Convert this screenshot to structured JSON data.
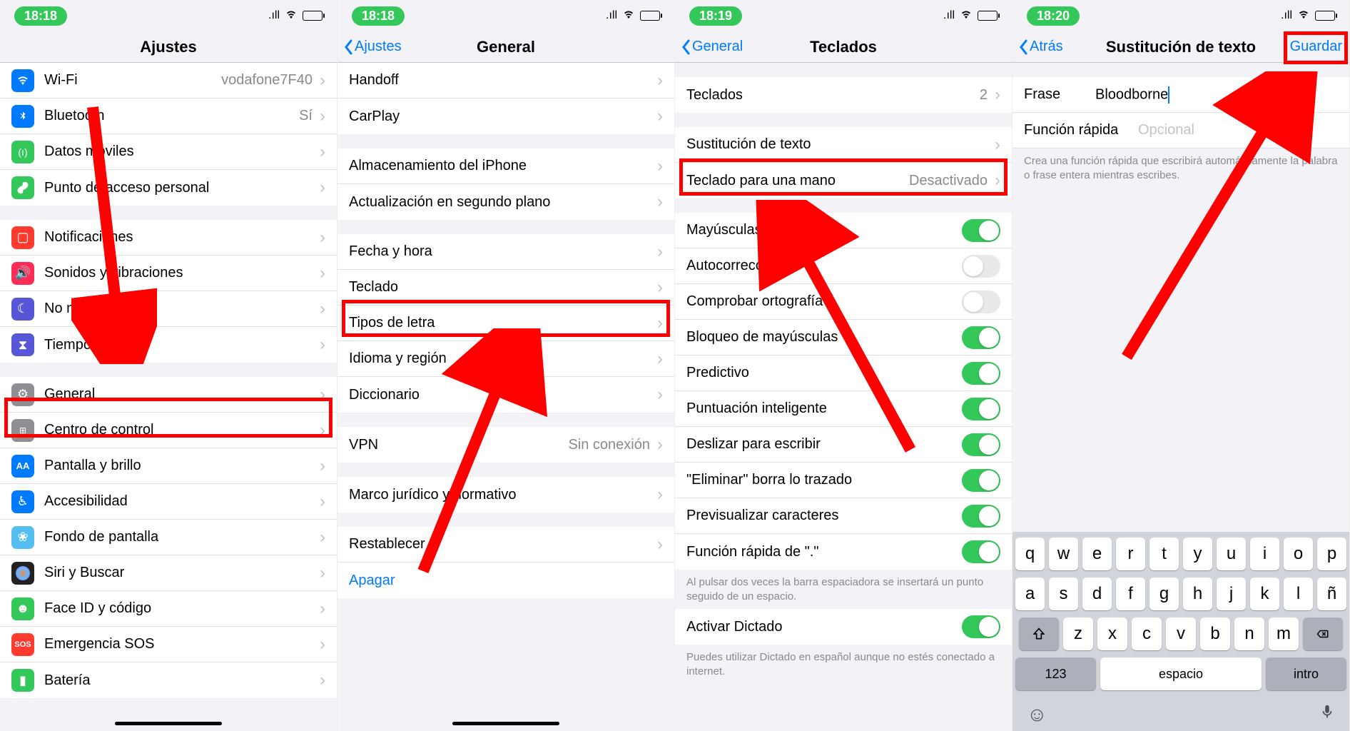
{
  "screen1": {
    "time": "18:18",
    "title": "Ajustes",
    "rows_g1": [
      {
        "label": "Wi-Fi",
        "value": "vodafone7F40",
        "icon_bg": "#007aff",
        "icon": "wifi"
      },
      {
        "label": "Bluetooth",
        "value": "Sí",
        "icon_bg": "#007aff",
        "icon": "bt"
      },
      {
        "label": "Datos móviles",
        "value": "",
        "icon_bg": "#34c759",
        "icon": "ant"
      },
      {
        "label": "Punto de acceso personal",
        "value": "",
        "icon_bg": "#34c759",
        "icon": "link"
      }
    ],
    "rows_g2": [
      {
        "label": "Notificaciones",
        "icon_bg": "#ff3b30",
        "icon": "notif"
      },
      {
        "label": "Sonidos y vibraciones",
        "icon_bg": "#ff2d55",
        "icon": "snd"
      },
      {
        "label": "No molestar",
        "icon_bg": "#5856d6",
        "icon": "moon"
      },
      {
        "label": "Tiempo de uso",
        "icon_bg": "#5856d6",
        "icon": "hour"
      }
    ],
    "rows_g3": [
      {
        "label": "General",
        "icon_bg": "#8e8e93",
        "icon": "gear",
        "highlight": true
      },
      {
        "label": "Centro de control",
        "icon_bg": "#8e8e93",
        "icon": "ctrl"
      },
      {
        "label": "Pantalla y brillo",
        "icon_bg": "#007aff",
        "icon": "AA"
      },
      {
        "label": "Accesibilidad",
        "icon_bg": "#007aff",
        "icon": "acc"
      },
      {
        "label": "Fondo de pantalla",
        "icon_bg": "#55bef0",
        "icon": "wall"
      },
      {
        "label": "Siri y Buscar",
        "icon_bg": "#222",
        "icon": "siri"
      },
      {
        "label": "Face ID y código",
        "icon_bg": "#34c759",
        "icon": "face"
      },
      {
        "label": "Emergencia SOS",
        "icon_bg": "#ff3b30",
        "icon": "sos"
      },
      {
        "label": "Batería",
        "icon_bg": "#34c759",
        "icon": "batt"
      }
    ]
  },
  "screen2": {
    "time": "18:18",
    "back": "Ajustes",
    "title": "General",
    "rows_g1": [
      {
        "label": "Handoff"
      },
      {
        "label": "CarPlay"
      }
    ],
    "rows_g2": [
      {
        "label": "Almacenamiento del iPhone"
      },
      {
        "label": "Actualización en segundo plano"
      }
    ],
    "rows_g3": [
      {
        "label": "Fecha y hora"
      },
      {
        "label": "Teclado",
        "highlight": true
      },
      {
        "label": "Tipos de letra"
      },
      {
        "label": "Idioma y región"
      },
      {
        "label": "Diccionario"
      }
    ],
    "rows_g4": [
      {
        "label": "VPN",
        "value": "Sin conexión"
      }
    ],
    "rows_g5": [
      {
        "label": "Marco jurídico y normativo"
      }
    ],
    "rows_g6": [
      {
        "label": "Restablecer"
      },
      {
        "label": "Apagar",
        "link": true
      }
    ]
  },
  "screen3": {
    "time": "18:19",
    "back": "General",
    "title": "Teclados",
    "rows_g1": [
      {
        "label": "Teclados",
        "value": "2"
      }
    ],
    "rows_g2": [
      {
        "label": "Sustitución de texto",
        "highlight": true
      },
      {
        "label": "Teclado para una mano",
        "value": "Desactivado"
      }
    ],
    "toggles": [
      {
        "label": "Mayúsculas automáticas",
        "on": true
      },
      {
        "label": "Autocorrección",
        "on": false
      },
      {
        "label": "Comprobar ortografía",
        "on": false
      },
      {
        "label": "Bloqueo de mayúsculas",
        "on": true
      },
      {
        "label": "Predictivo",
        "on": true
      },
      {
        "label": "Puntuación inteligente",
        "on": true
      },
      {
        "label": "Deslizar para escribir",
        "on": true
      },
      {
        "label": "\"Eliminar\" borra lo trazado",
        "on": true
      },
      {
        "label": "Previsualizar caracteres",
        "on": true
      },
      {
        "label": "Función rápida de \".\"",
        "on": true
      }
    ],
    "footnote1": "Al pulsar dos veces la barra espaciadora se insertará un punto seguido de un espacio.",
    "rows_g4": [
      {
        "label": "Activar Dictado",
        "on": true
      }
    ],
    "footnote2": "Puedes utilizar Dictado en español aunque no estés conectado a internet."
  },
  "screen4": {
    "time": "18:20",
    "back": "Atrás",
    "title": "Sustitución de texto",
    "save": "Guardar",
    "frase_label": "Frase",
    "frase_value": "Bloodborne",
    "func_label": "Función rápida",
    "func_placeholder": "Opcional",
    "note": "Crea una función rápida que escribirá automáticamente la palabra o frase entera mientras escribes.",
    "kb": {
      "r1": [
        "q",
        "w",
        "e",
        "r",
        "t",
        "y",
        "u",
        "i",
        "o",
        "p"
      ],
      "r2": [
        "a",
        "s",
        "d",
        "f",
        "g",
        "h",
        "j",
        "k",
        "l",
        "ñ"
      ],
      "r3": [
        "z",
        "x",
        "c",
        "v",
        "b",
        "n",
        "m"
      ],
      "num": "123",
      "space": "espacio",
      "intro": "intro"
    }
  }
}
